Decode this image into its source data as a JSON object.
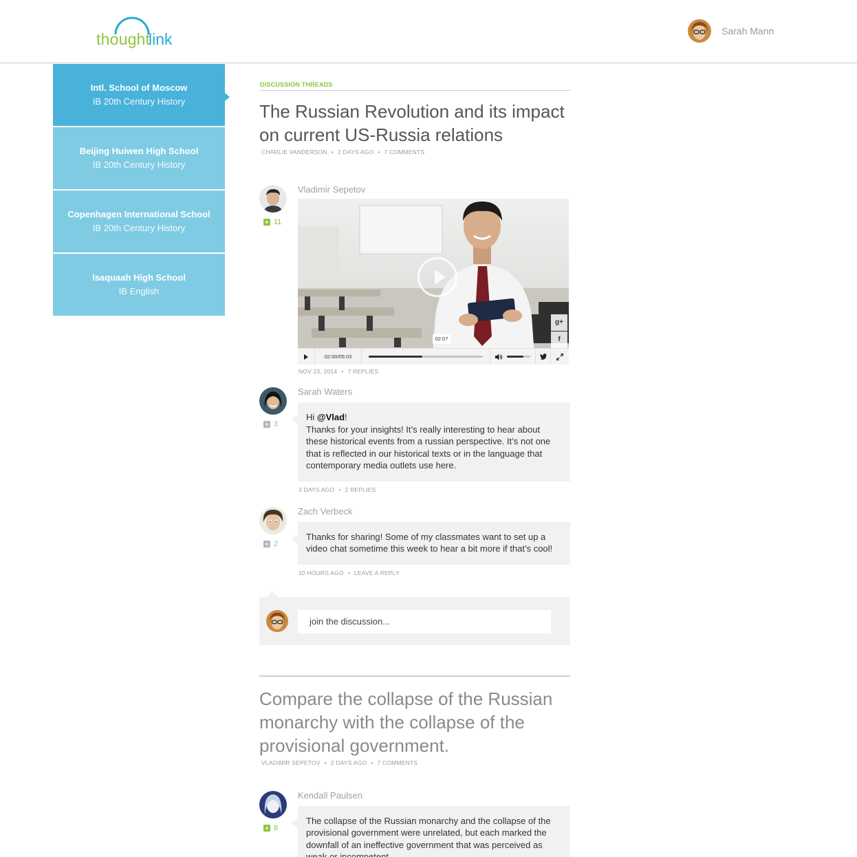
{
  "header": {
    "logo_part1": "thought",
    "logo_part2": "link",
    "user_name": "Sarah Mann",
    "brand_green": "#8cc63f",
    "brand_blue": "#29a8d8"
  },
  "sidebar": {
    "items": [
      {
        "title": "Intl. School of Moscow",
        "subtitle": "IB 20th Century History",
        "active": true
      },
      {
        "title": "Beijing Huiwen High School",
        "subtitle": "IB 20th Century History",
        "active": false
      },
      {
        "title": "Copenhagen International School",
        "subtitle": "IB 20th Century History",
        "active": false
      },
      {
        "title": "Isaquaah High School",
        "subtitle": "IB English",
        "active": false
      }
    ]
  },
  "section_label": "DISCUSSION THREADS",
  "thread1": {
    "title": "The Russian Revolution and its impact on current US-Russia relations",
    "author": "CHARLIE VANDERSON",
    "age": "2 DAYS AGO",
    "comments": "7 COMMENTS",
    "posts": [
      {
        "author": "Vladimir Sepetov",
        "votes": "11",
        "video": {
          "time": "02:00/05:03",
          "hover_time": "02:07",
          "progress": 0.47,
          "volume": 0.7,
          "share": [
            "g+",
            "f"
          ]
        },
        "date": "NOV 23, 2014",
        "replies": "7 REPLIES"
      },
      {
        "author": "Sarah Waters",
        "votes": "3",
        "greeting": "Hi ",
        "mention": "@Vlad",
        "greeting_end": "!",
        "body": "Thanks for your insights! It’s really interesting to hear about these historical events from a russian perspective. It’s not one that is reflected in our historical texts or in the language that contemporary media outlets use here.",
        "date": "3 DAYS AGO",
        "replies": "2 REPLIES"
      },
      {
        "author": "Zach Verbeck",
        "votes": "2",
        "body": "Thanks for sharing! Some of my classmates want to set up a video chat sometime this week to hear a bit more if that’s cool!",
        "date": "10 HOURS AGO",
        "replies": "LEAVE A REPLY"
      }
    ],
    "composer_placeholder": "join the discussion..."
  },
  "thread2": {
    "title": "Compare the collapse of the Russian monarchy with the collapse of the provisional  government.",
    "author": "VLADIMIR SEPETOV",
    "age": "2 DAYS AGO",
    "comments": "7 COMMENTS",
    "posts": [
      {
        "author": "Kendall Paulsen",
        "votes": "8",
        "body": "The collapse of the Russian monarchy and the collapse of the provisional government were unrelated, but each marked the downfall of an ineffective government that was perceived as weak or incompetent."
      }
    ]
  }
}
